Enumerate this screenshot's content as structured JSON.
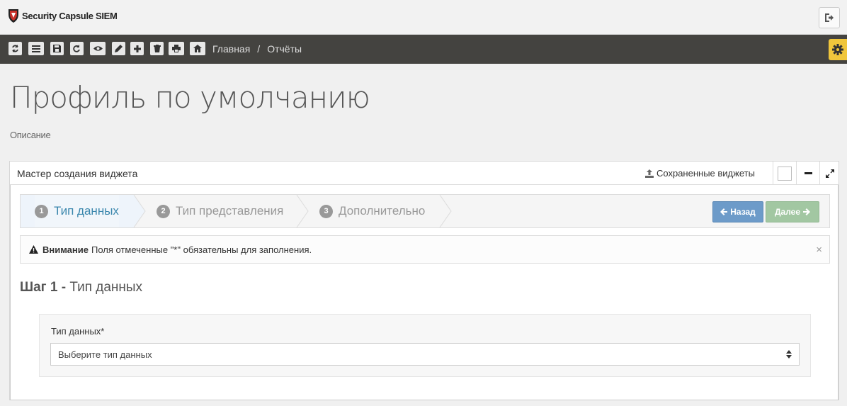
{
  "app": {
    "title": "Security Capsule SIEM"
  },
  "toolbar": {
    "icons": [
      "refresh-icon",
      "list-icon",
      "save-icon",
      "redo-icon",
      "eye-icon",
      "pencil-icon",
      "plus-icon",
      "trash-icon",
      "print-icon",
      "home-icon"
    ],
    "breadcrumbs": [
      "Главная",
      "Отчёты"
    ],
    "separator": "/"
  },
  "page": {
    "title": "Профиль по умолчанию",
    "description": "Описание"
  },
  "widget": {
    "title": "Мастер создания виджета",
    "saved_label": "Сохраненные виджеты",
    "steps": [
      {
        "num": "1",
        "label": "Тип данных",
        "active": true
      },
      {
        "num": "2",
        "label": "Тип представления",
        "active": false
      },
      {
        "num": "3",
        "label": "Дополнительно",
        "active": false
      }
    ],
    "prev_label": "Назад",
    "next_label": "Далее",
    "alert": {
      "strong": "Внимание",
      "text": "Поля отмеченные \"*\" обязательны для заполнения.",
      "close": "×"
    },
    "step_heading": {
      "prefix": "Шаг 1 -",
      "text": "Тип данных"
    },
    "field": {
      "label": "Тип данных*",
      "placeholder": "Выберите тип данных"
    }
  },
  "colors": {
    "toolbar_bg": "#444340",
    "accent_gear": "#f0c63c",
    "prev_btn": "#6d9bc9",
    "next_btn": "#a2c7a2",
    "active_step": "#3a87ad"
  }
}
